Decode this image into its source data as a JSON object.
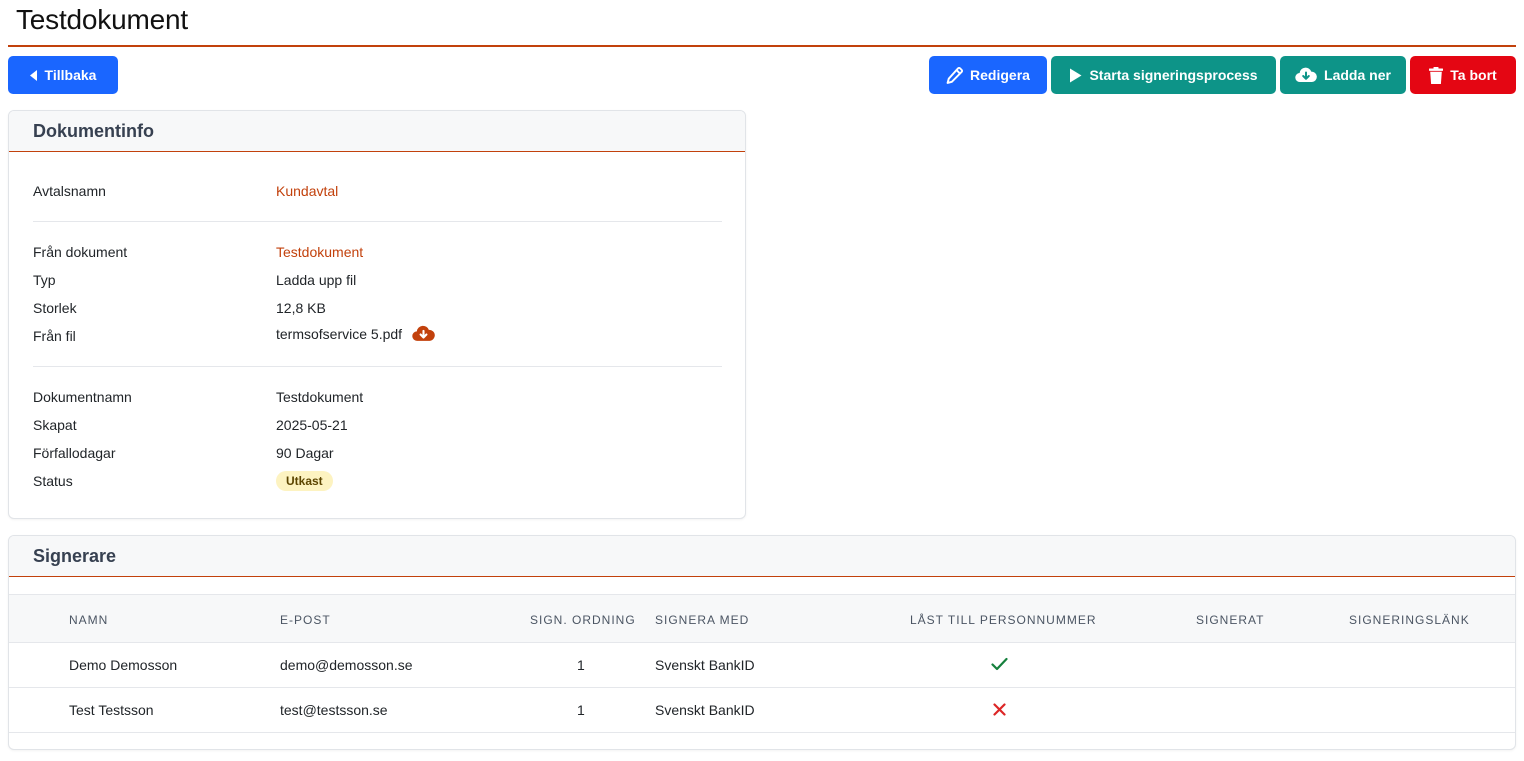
{
  "page": {
    "title": "Testdokument"
  },
  "toolbar": {
    "back_label": "Tillbaka",
    "edit_label": "Redigera",
    "start_label": "Starta signeringsprocess",
    "download_label": "Ladda ner",
    "delete_label": "Ta bort"
  },
  "colors": {
    "accent": "#c2410c",
    "primary": "#1a66ff",
    "teal": "#0d9488",
    "danger": "#e40613"
  },
  "doc_info": {
    "header": "Dokumentinfo",
    "agreement_label": "Avtalsnamn",
    "agreement_value": "Kundavtal",
    "from_doc_label": "Från dokument",
    "from_doc_value": "Testdokument",
    "type_label": "Typ",
    "type_value": "Ladda upp fil",
    "size_label": "Storlek",
    "size_value": "12,8 KB",
    "file_label": "Från fil",
    "file_value": "termsofservice 5.pdf",
    "docname_label": "Dokumentnamn",
    "docname_value": "Testdokument",
    "created_label": "Skapat",
    "created_value": "2025-05-21",
    "due_label": "Förfallodagar",
    "due_value": "90 Dagar",
    "status_label": "Status",
    "status_value": "Utkast"
  },
  "signers": {
    "header": "Signerare",
    "columns": [
      "NAMN",
      "E-POST",
      "SIGN. ORDNING",
      "SIGNERA MED",
      "LÅST TILL PERSONNUMMER",
      "SIGNERAT",
      "SIGNERINGSLÄNK"
    ],
    "rows": [
      {
        "name": "Demo Demosson",
        "email": "demo@demosson.se",
        "order": "1",
        "method": "Svenskt BankID",
        "locked": true,
        "signed": "",
        "link": ""
      },
      {
        "name": "Test Testsson",
        "email": "test@testsson.se",
        "order": "1",
        "method": "Svenskt BankID",
        "locked": false,
        "signed": "",
        "link": ""
      }
    ]
  }
}
